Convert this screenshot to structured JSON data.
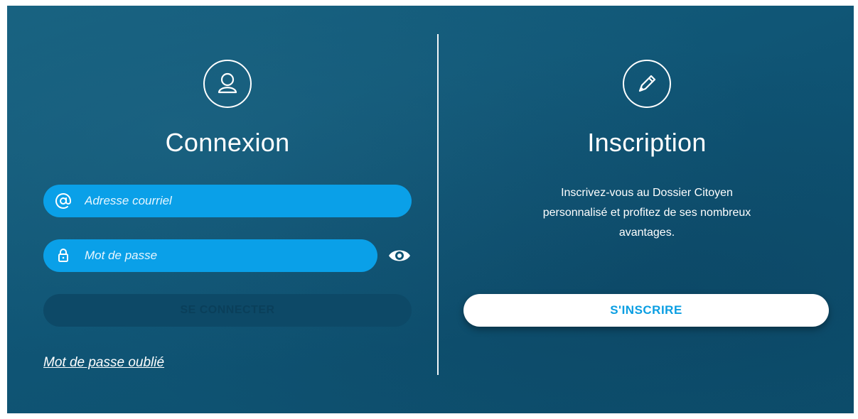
{
  "login": {
    "title": "Connexion",
    "email_placeholder": "Adresse courriel",
    "password_placeholder": "Mot de passe",
    "submit_label": "SE CONNECTER",
    "forgot_password": "Mot de passe oublié"
  },
  "signup": {
    "title": "Inscription",
    "description_lines": [
      "Inscrivez-vous au Dossier Citoyen",
      "personnalisé et profitez de ses nombreux",
      "avantages."
    ],
    "button_label": "S'INSCRIRE"
  },
  "icons": {
    "login": "user-icon",
    "signup": "pencil-icon",
    "email": "at-sign-icon",
    "password": "lock-icon",
    "toggle_password": "eye-icon"
  },
  "colors": {
    "background": "#0f5474",
    "input_fill": "#0aa0e8",
    "disabled_button": "#0d4967",
    "signup_text": "#0a9ee2"
  }
}
